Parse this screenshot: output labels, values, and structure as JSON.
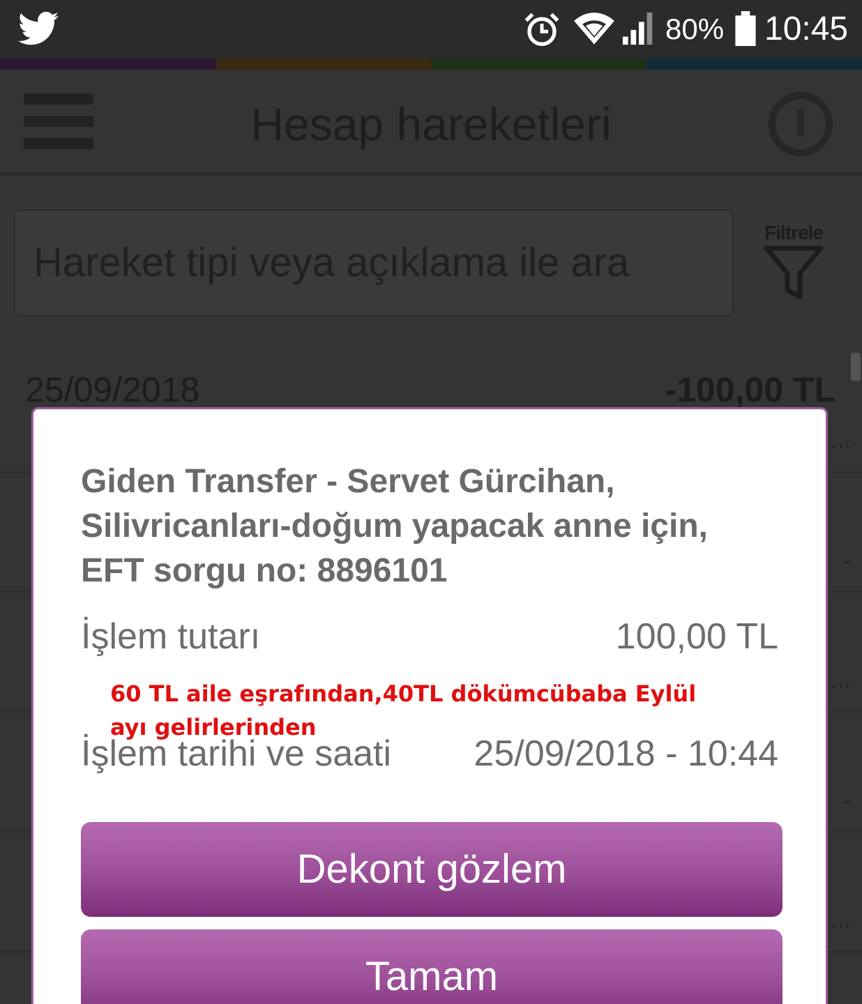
{
  "status_bar": {
    "battery_percent": "80%",
    "time": "10:45",
    "icons": [
      "twitter-icon",
      "alarm-icon",
      "wifi-icon",
      "signal-icon",
      "battery-icon"
    ]
  },
  "stripe_colors": [
    "#2a1630",
    "#3a2a10",
    "#1d3018",
    "#102a38"
  ],
  "header": {
    "title": "Hesap hareketleri"
  },
  "search": {
    "placeholder": "Hareket tipi veya açıklama ile ara",
    "filter_label": "Filtrele"
  },
  "transactions": [
    {
      "date": "25/09/2018",
      "amount": "-100,00 TL"
    }
  ],
  "dialog": {
    "title": "Giden Transfer - Servet Gürcihan, Silivricanları-doğum yapacak anne için, EFT sorgu no: 8896101",
    "amount_label": "İşlem tutarı",
    "amount_value": "100,00 TL",
    "note": "60 TL aile eşrafından,40TL dökümcübaba Eylül ayı gelirlerinden",
    "date_label": "İşlem tarihi ve saati",
    "date_value": "25/09/2018 - 10:44",
    "primary_button": "Dekont gözlem",
    "secondary_button": "Tamam"
  },
  "colors": {
    "button_purple": "#9c4f98",
    "dialog_border": "#a05aa0",
    "note_red": "#e01010"
  }
}
